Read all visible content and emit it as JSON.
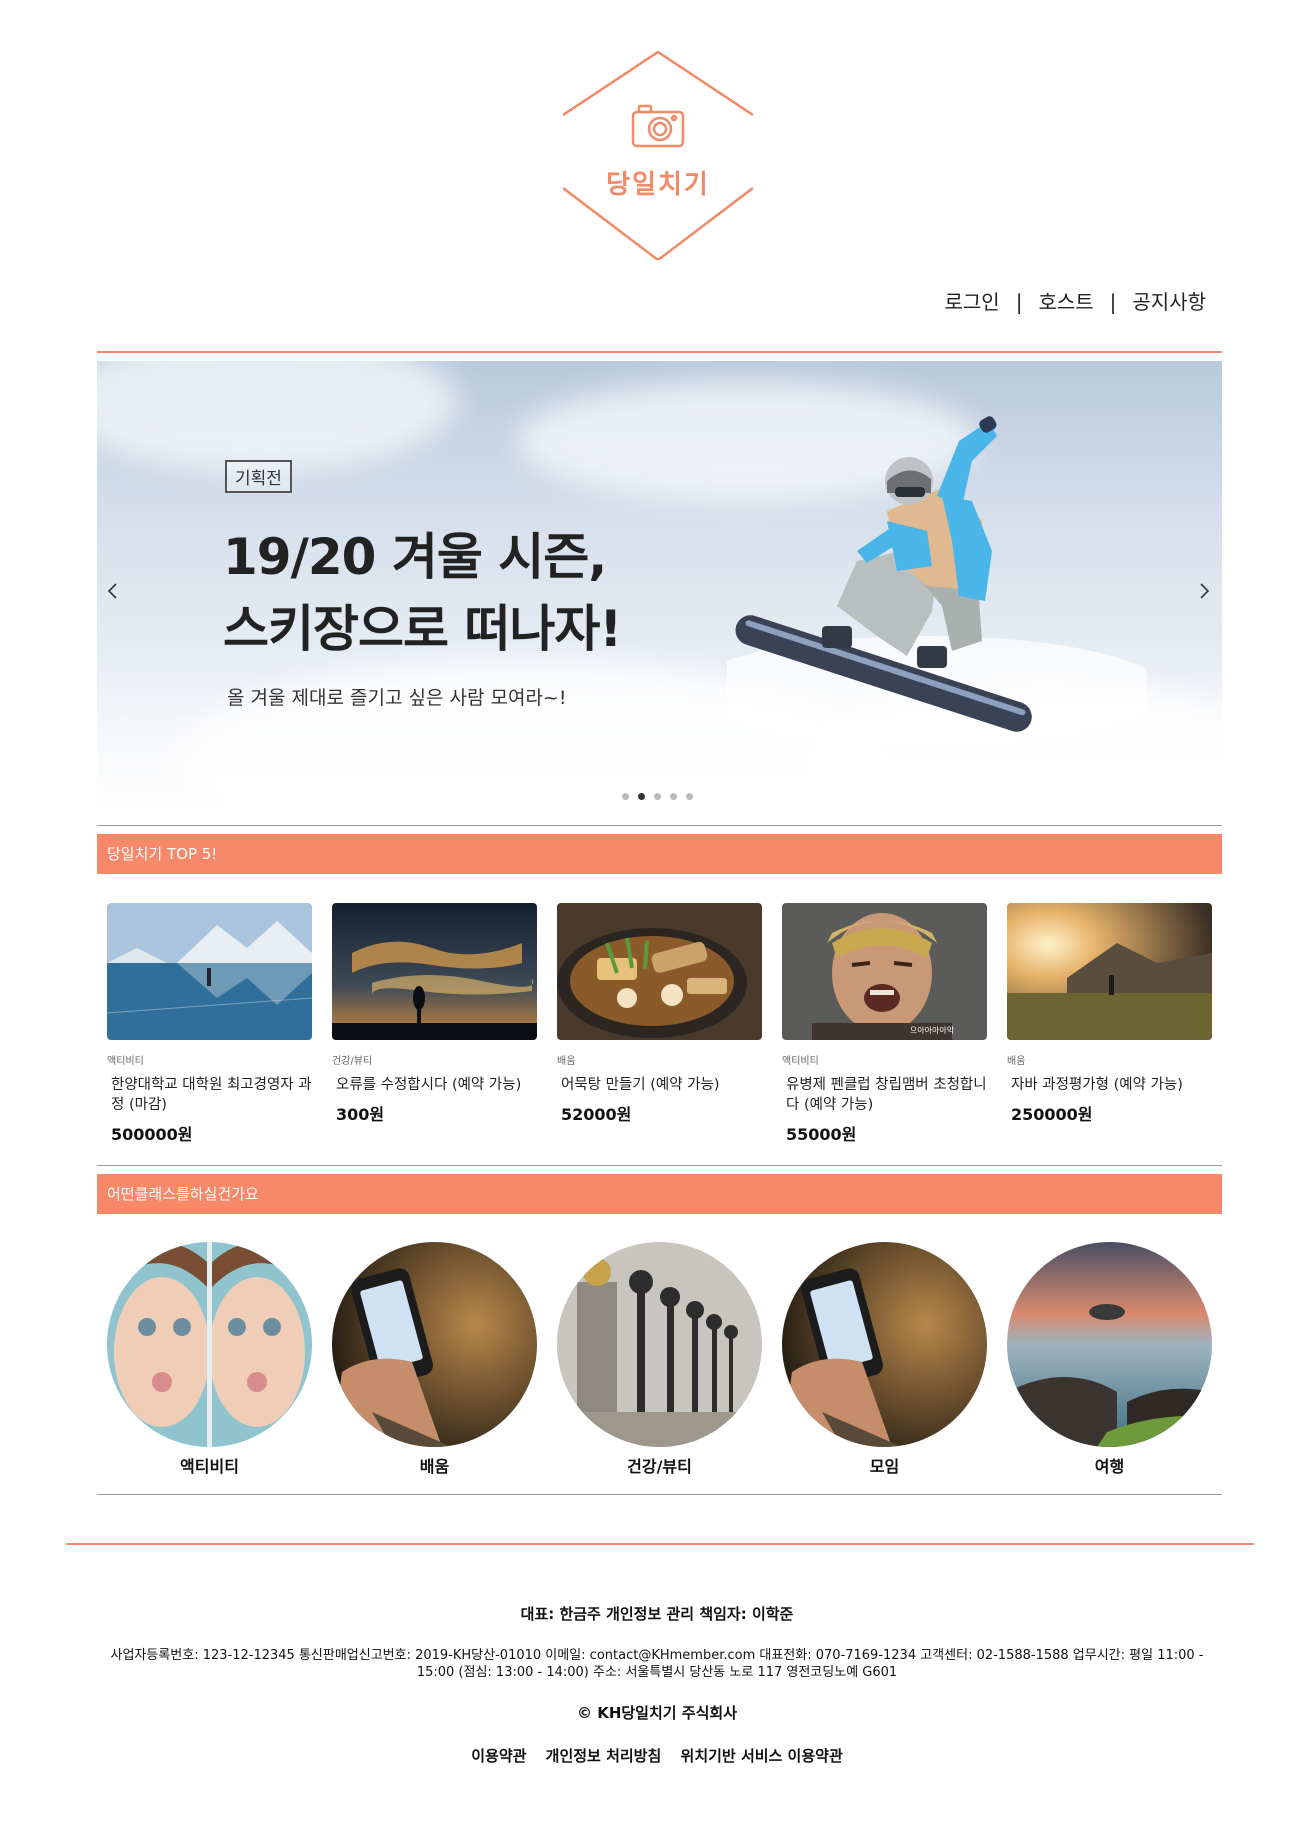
{
  "brand": {
    "name": "당일치기",
    "accent": "#f7896a",
    "logo_icon": "camera-icon"
  },
  "topnav": {
    "items": [
      "로그인",
      "호스트",
      "공지사항"
    ],
    "separator": "|"
  },
  "banner": {
    "badge": "기획전",
    "headline_line1": "19/20 겨울 시즌,",
    "headline_line2": "스키장으로 떠나자!",
    "subhead": "올 겨울 제대로 즐기고 싶은 사람 모여라~!",
    "prev_icon": "chevron-left-icon",
    "next_icon": "chevron-right-icon",
    "slide_count": 5,
    "active_slide": 2
  },
  "top5": {
    "title": "당일치기 TOP 5!",
    "items": [
      {
        "category": "액티비티",
        "title": "한양대학교 대학원 최고경영자 과정 (마감)",
        "price": "500000원"
      },
      {
        "category": "건강/뷰티",
        "title": "오류를 수정합시다 (예약 가능)",
        "price": "300원"
      },
      {
        "category": "배움",
        "title": "어묵탕 만들기 (예약 가능)",
        "price": "52000원"
      },
      {
        "category": "액티비티",
        "title": "유병제 펜클럽 창립맴버 초청합니다 (예약 가능)",
        "price": "55000원"
      },
      {
        "category": "배움",
        "title": "자바 과정평가형 (예약 가능)",
        "price": "250000원"
      }
    ],
    "photo_caption": "으아아아아악"
  },
  "classes": {
    "title": "어떤클래스를하실건가요",
    "items": [
      "액티비티",
      "배움",
      "건강/뷰티",
      "모임",
      "여행"
    ]
  },
  "footer": {
    "line1": "대표: 한금주 개인정보 관리 책임자: 이학준",
    "line2": "사업자등록번호: 123-12-12345 통신판매업신고번호: 2019-KH당산-01010 이메일: contact@KHmember.com 대표전화: 070-7169-1234 고객센터: 02-1588-1588 업무시간: 평일 11:00 - 15:00 (점심: 13:00 - 14:00) 주소: 서울특별시 당산동 노로 117 영전코딩노예 G601",
    "copyright": "© KH당일치기 주식회사",
    "links": [
      "이용약관",
      "개인정보 처리방침",
      "위치기반 서비스 이용약관"
    ]
  }
}
